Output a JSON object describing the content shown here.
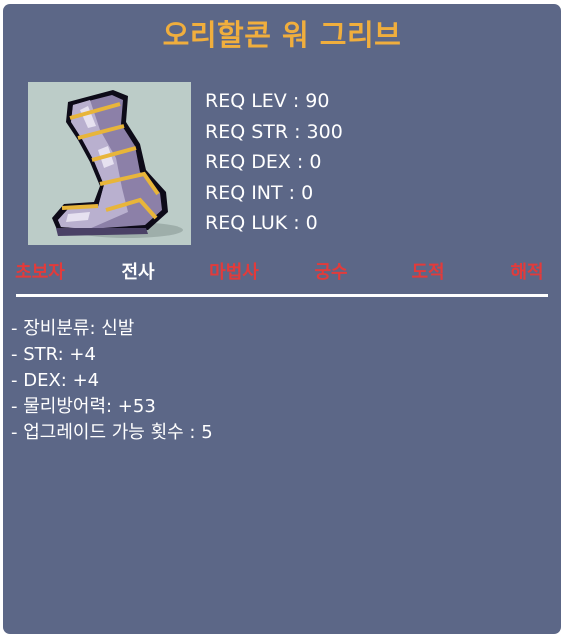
{
  "item": {
    "name": "오리할콘 워 그리브",
    "image_icon": "purple-boot-icon"
  },
  "requirements": [
    {
      "label": "REQ LEV : 90"
    },
    {
      "label": "REQ STR : 300"
    },
    {
      "label": "REQ DEX : 0"
    },
    {
      "label": "REQ INT : 0"
    },
    {
      "label": "REQ LUK : 0"
    }
  ],
  "classes": [
    {
      "name": "초보자",
      "color": "#e23b3b"
    },
    {
      "name": "전사",
      "color": "#ffffff"
    },
    {
      "name": "마법사",
      "color": "#e23b3b"
    },
    {
      "name": "궁수",
      "color": "#e23b3b"
    },
    {
      "name": "도적",
      "color": "#e23b3b"
    },
    {
      "name": "해적",
      "color": "#e23b3b"
    }
  ],
  "stats": [
    {
      "text": "- 장비분류: 신발"
    },
    {
      "text": "- STR: +4"
    },
    {
      "text": "- DEX: +4"
    },
    {
      "text": "- 물리방어력: +53"
    },
    {
      "text": "- 업그레이드 가능 횟수 : 5"
    }
  ],
  "colors": {
    "panel_background": "#5c6787",
    "title": "#f0ae3d",
    "allowed_class": "#ffffff",
    "disallowed_class": "#e23b3b",
    "image_background": "#bcccc8"
  }
}
